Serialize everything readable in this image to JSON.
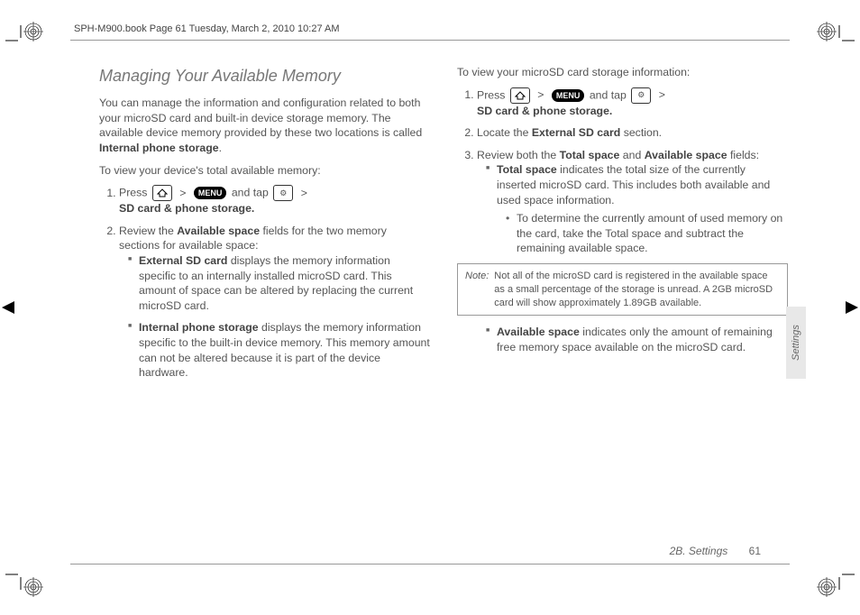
{
  "book_header": "SPH-M900.book  Page 61  Tuesday, March 2, 2010  10:27 AM",
  "left": {
    "heading": "Managing Your Available Memory",
    "intro_pre": "You can manage the information and configuration related to both your microSD card and built-in device storage memory. The available device memory provided by these two locations is called ",
    "intro_bold": "Internal phone storage",
    "intro_post": ".",
    "subhead": "To view your device's total available memory:",
    "step1_press": "Press ",
    "step1_and_tap": " and tap ",
    "step1_path": "SD card & phone storage.",
    "menu_label": "MENU",
    "gt": ">",
    "step2_pre": "Review the ",
    "step2_bold": "Available space",
    "step2_post": " fields for the two memory sections for available space:",
    "b1_bold": "External SD card",
    "b1_text": " displays the memory information specific to an internally installed microSD card. This amount of space can be altered by replacing the current microSD card.",
    "b2_bold": "Internal phone storage",
    "b2_text": " displays the memory information specific to the built-in device memory. This memory amount can not be altered because it is part of the device hardware."
  },
  "right": {
    "subhead": "To view your microSD card storage information:",
    "step1_press": "Press ",
    "step1_and_tap": " and tap ",
    "step1_path": "SD card & phone storage.",
    "menu_label": "MENU",
    "gt": ">",
    "step2_pre": "Locate the ",
    "step2_bold": "External SD card",
    "step2_post": " section.",
    "step3_pre": "Review both the ",
    "step3_bold1": "Total space",
    "step3_mid": " and ",
    "step3_bold2": "Available space",
    "step3_post": " fields:",
    "b1_bold": "Total space",
    "b1_text": " indicates the total size of the currently inserted microSD card. This includes both available and used space information.",
    "b1_sub": "To determine the currently amount of used memory on the card, take the Total space and subtract the remaining available space.",
    "note_label": "Note:",
    "note_text": "Not all of the microSD card is registered in the available space as a small percentage of the storage is unread. A 2GB microSD card will show approximately 1.89GB available.",
    "b2_bold": "Available space",
    "b2_text": " indicates only the amount of remaining free memory space available on the microSD card."
  },
  "side_tab": "Settings",
  "footer_section": "2B. Settings",
  "footer_page": "61"
}
